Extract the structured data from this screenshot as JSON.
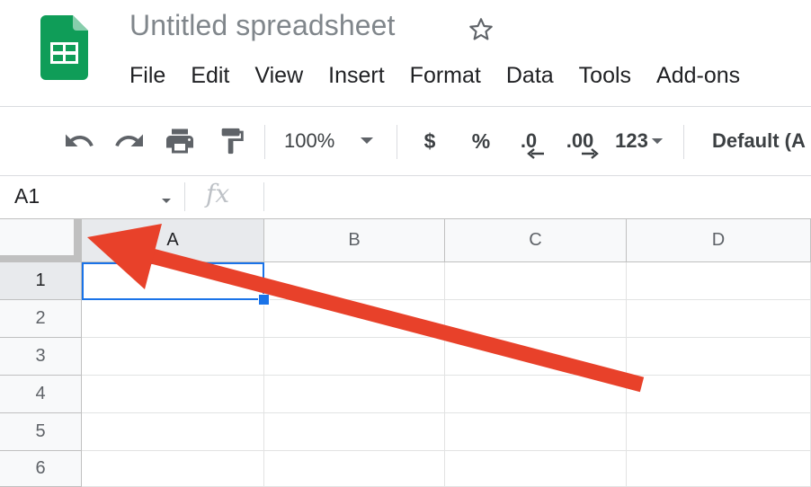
{
  "document": {
    "title": "Untitled spreadsheet",
    "star_icon": "star-outline-icon",
    "logo_icon": "sheets-logo-icon",
    "logo_color": "#0f9d58"
  },
  "menu": {
    "items": [
      "File",
      "Edit",
      "View",
      "Insert",
      "Format",
      "Data",
      "Tools",
      "Add-ons"
    ]
  },
  "toolbar": {
    "undo_icon": "undo-icon",
    "redo_icon": "redo-icon",
    "print_icon": "print-icon",
    "paint_format_icon": "paint-format-icon",
    "zoom": "100%",
    "currency": "$",
    "percent": "%",
    "decrease_decimal": ".0",
    "increase_decimal": ".00",
    "more_formats": "123",
    "font": "Default (A"
  },
  "formula_bar": {
    "name_box": "A1",
    "fx": "fx",
    "value": ""
  },
  "grid": {
    "columns": [
      "A",
      "B",
      "C",
      "D"
    ],
    "rows": [
      "1",
      "2",
      "3",
      "4",
      "5",
      "6"
    ],
    "selected_cell": "A1",
    "selection_color": "#1a73e8"
  },
  "annotation": {
    "arrow_color": "#e8412a"
  }
}
